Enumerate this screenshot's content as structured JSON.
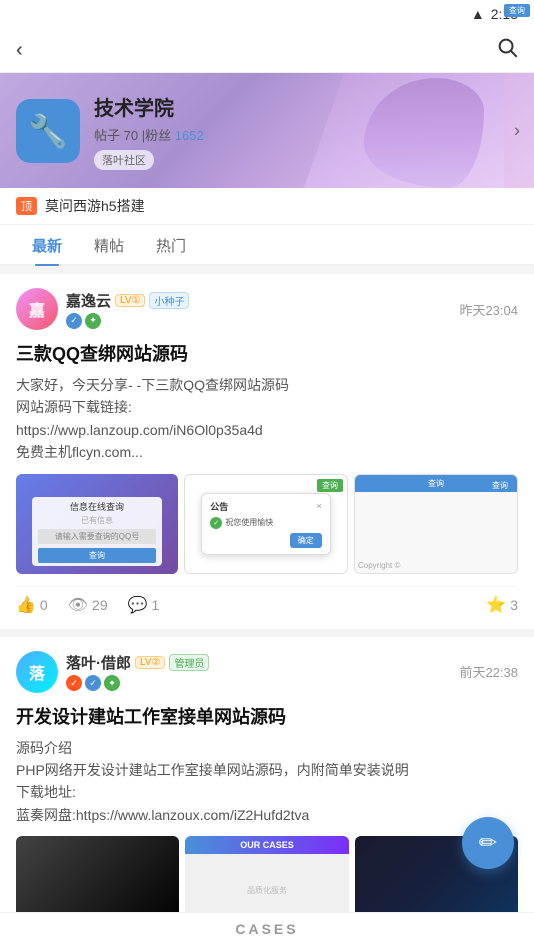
{
  "status_bar": {
    "time": "2:13",
    "wifi_icon": "wifi",
    "signal_icon": "signal"
  },
  "top_nav": {
    "back_label": "‹",
    "search_label": "⌕"
  },
  "community": {
    "name": "技术学院",
    "posts_label": "帖子",
    "posts_count": "70",
    "followers_label": "粉丝",
    "followers_count": "1652",
    "tag": "落叶社区",
    "arrow": "›"
  },
  "pinned": {
    "badge": "顶",
    "text": "莫问西游h5搭建"
  },
  "tabs": [
    {
      "label": "最新",
      "active": true
    },
    {
      "label": "精帖",
      "active": false
    },
    {
      "label": "热门",
      "active": false
    }
  ],
  "post1": {
    "author": "嘉逸云",
    "badge_level": "LV①",
    "badge_type": "小种子",
    "time": "昨天23:04",
    "title": "三款QQ查绑网站源码",
    "content_lines": [
      "大家好，今天分享- -下三款QQ查绑网站源码",
      "网站源码下载链接:",
      "https://wwp.lanzoup.com/iN6Ol0p35a4d",
      "免费主机flcyn.com..."
    ],
    "image1_tag": "查询",
    "image2_dialog_title": "公告",
    "image2_dialog_close": "×",
    "image2_dialog_text": "祝您使用愉快",
    "image2_dialog_btn": "确定",
    "image2_tag": "查询",
    "image3_header": "查询",
    "image3_copyright": "Copyright ©",
    "image3_tag": "查询",
    "likes": "0",
    "views": "29",
    "comments": "1",
    "stars": "3"
  },
  "post2": {
    "author": "落叶·借郎",
    "badge_level": "LV②",
    "badge_type": "管理员",
    "time": "前天22:38",
    "title": "开发设计建站工作室接单网站源码",
    "content_lines": [
      "源码介绍",
      "PHP网络开发设计建站工作室接单网站源码，内附简单安装说明",
      "下载地址:",
      "蓝奏网盘:https://www.lanzoux.com/iZ2Hufd2tva"
    ],
    "thumb2_header": "OUR CASES",
    "thumb2_sub": "品质化服务"
  },
  "fab": {
    "icon": "✏"
  },
  "bottom_nav": {
    "label": "CASES"
  }
}
